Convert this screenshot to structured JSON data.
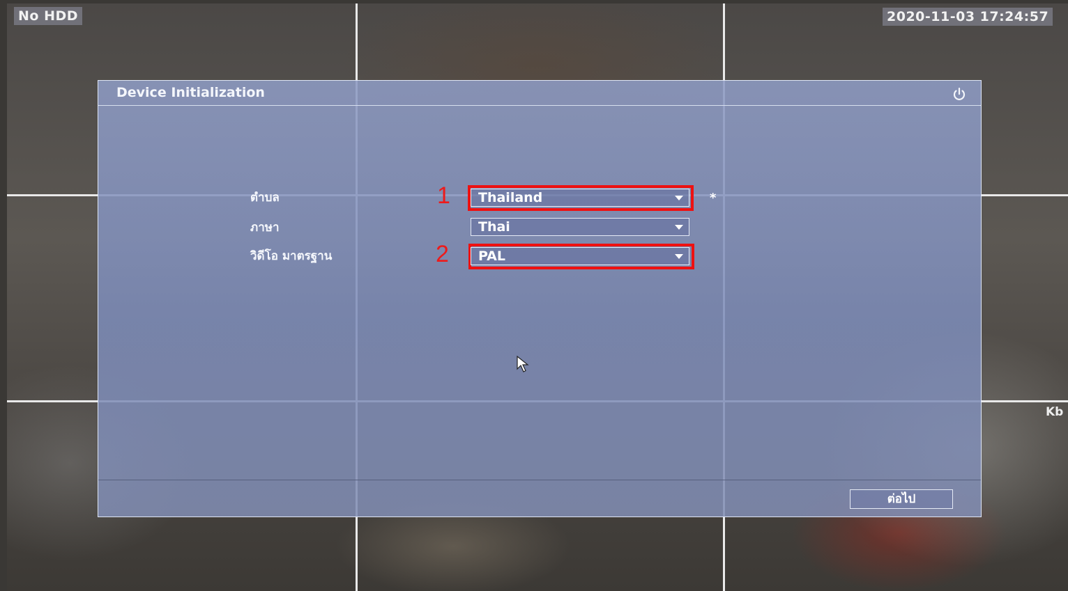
{
  "osd": {
    "status": "No HDD",
    "datetime": "2020-11-03 17:24:57",
    "edge_text": "Kb"
  },
  "dialog": {
    "title": "Device Initialization",
    "power_icon": "power-icon",
    "fields": [
      {
        "label": "ตำบล",
        "value": "Thailand"
      },
      {
        "label": "ภาษา",
        "value": "Thai"
      },
      {
        "label": "วิดีโอ มาตรฐาน",
        "value": "PAL"
      }
    ],
    "required_mark": "*",
    "next_label": "ต่อไป"
  },
  "annotations": {
    "marker_1": "1",
    "marker_2": "2",
    "highlight_color": "#ee1111"
  }
}
